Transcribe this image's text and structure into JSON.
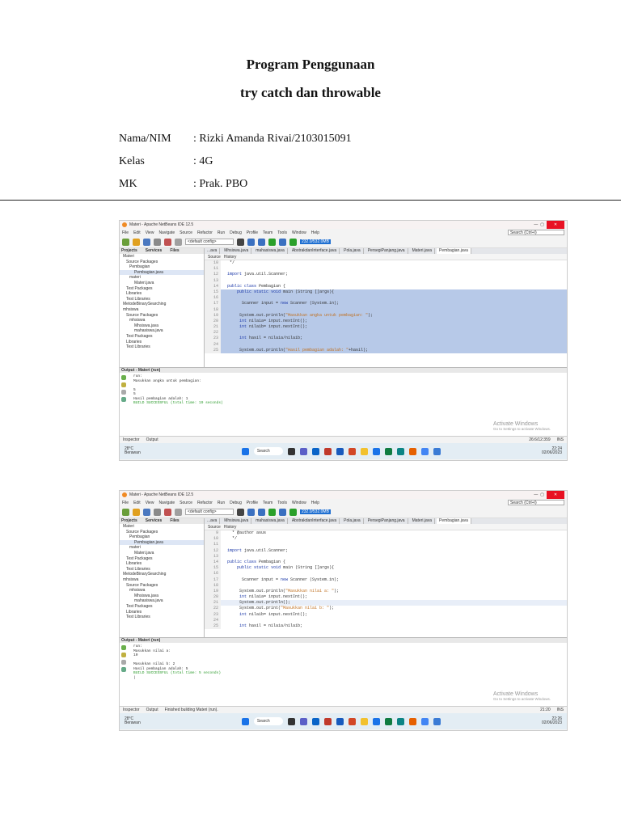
{
  "doc": {
    "title1": "Program Penggunaan",
    "title2": "try catch dan throwable",
    "info": [
      {
        "k": "Nama/NIM",
        "v": ": Rizki Amanda Rivai/2103015091"
      },
      {
        "k": "Kelas",
        "v": ": 4G"
      },
      {
        "k": "MK",
        "v": ": Prak. PBO"
      }
    ]
  },
  "common": {
    "window_title": "Materi - Apache NetBeans IDE 12.5",
    "menu": [
      "File",
      "Edit",
      "View",
      "Navigate",
      "Source",
      "Refactor",
      "Run",
      "Debug",
      "Profile",
      "Team",
      "Tools",
      "Window",
      "Help"
    ],
    "search": "Search (Ctrl+I)",
    "config": "<default config>",
    "memory": "232.0/532.0MB",
    "panel_tabs": [
      "Projects",
      "Services",
      "Files"
    ],
    "file_tabs": [
      "...ava",
      "Mhsiswa.java",
      "mahasiswa.java",
      "AbstrakdanInterface.java",
      "Pola.java",
      "PersegiPanjang.java",
      "Materi.java",
      "Pembagian.java"
    ],
    "editor_tabs": [
      "Source",
      "History"
    ],
    "tree": [
      "Materi",
      "Source Packages",
      "Pembagian",
      "Pembagian.java",
      "materi",
      "Materi.java",
      "Test Packages",
      "Libraries",
      "Test Libraries",
      "MetodeBinarySearching",
      "mhsiswa",
      "Source Packages",
      "mhsiswa",
      "Mhsiswa.java",
      "mahasiswa.java",
      "Test Packages",
      "Libraries",
      "Test Libraries"
    ],
    "output_title": "Output - Materi (run)",
    "activate": "Activate Windows",
    "activate_sub": "Go to Settings to activate Windows.",
    "status_tabs": [
      "Inspector",
      "Output"
    ],
    "weather": "28°C",
    "weather_sub": "Berawan",
    "taskbar_search": "Search",
    "ins": "INS"
  },
  "shots": [
    {
      "code": [
        [
          "10",
          " */"
        ],
        [
          "11",
          ""
        ],
        [
          "12",
          "import java.util.Scanner;"
        ],
        [
          "13",
          ""
        ],
        [
          "14",
          "public class Pembagian {"
        ],
        [
          "15",
          "    public static void main (String []args){"
        ],
        [
          "16",
          ""
        ],
        [
          "17",
          "      Scanner input = new Scanner (System.in);"
        ],
        [
          "18",
          ""
        ],
        [
          "19",
          "     System.out.println(\"Masukkan angka untuk pembagian: \");"
        ],
        [
          "20",
          "     int nilaia= input.nextInt();"
        ],
        [
          "21",
          "     int nilaib= input.nextInt();"
        ],
        [
          "22",
          ""
        ],
        [
          "23",
          "     int hasil = nilaia/nilaib;"
        ],
        [
          "24",
          ""
        ],
        [
          "25",
          "     System.out.println(\"Hasil pembagian adalah: \"+hasil);"
        ]
      ],
      "output": [
        "run:",
        "Masukkan angka untuk pembagian:",
        "",
        "5",
        "5",
        "Hasil pembagian adalah: 1",
        "BUILD SUCCESSFUL (total time: 19 seconds)"
      ],
      "status_msg": "",
      "position": "26:6/12:359",
      "time": "22:24",
      "date": "02/06/2023"
    },
    {
      "code": [
        [
          "9",
          "  * @author asus"
        ],
        [
          "10",
          "  */"
        ],
        [
          "11",
          ""
        ],
        [
          "12",
          "import java.util.Scanner;"
        ],
        [
          "13",
          ""
        ],
        [
          "14",
          "public class Pembagian {"
        ],
        [
          "15",
          "    public static void main (String []args){"
        ],
        [
          "16",
          ""
        ],
        [
          "17",
          "      Scanner input = new Scanner (System.in);"
        ],
        [
          "18",
          ""
        ],
        [
          "19",
          "     System.out.println(\"Masukkan nilai a: \");"
        ],
        [
          "20",
          "     int nilaia= input.nextInt();"
        ],
        [
          "21",
          "     System.out.println();"
        ],
        [
          "22",
          "     System.out.print(\"Masukkan nilai b: \");"
        ],
        [
          "23",
          "     int nilaib= input.nextInt();"
        ],
        [
          "24",
          ""
        ],
        [
          "25",
          "     int hasil = nilaia/nilaib;"
        ]
      ],
      "output": [
        "run:",
        "Masukkan nilai a:",
        "10",
        "",
        "Masukkan nilai b: 2",
        "Hasil pembagian adalah: 5",
        "BUILD SUCCESSFUL (total time: 5 seconds)",
        "|"
      ],
      "status_msg": "Finished building Materi (run).",
      "position": "21:20",
      "time": "22:26",
      "date": "02/06/2023"
    }
  ]
}
